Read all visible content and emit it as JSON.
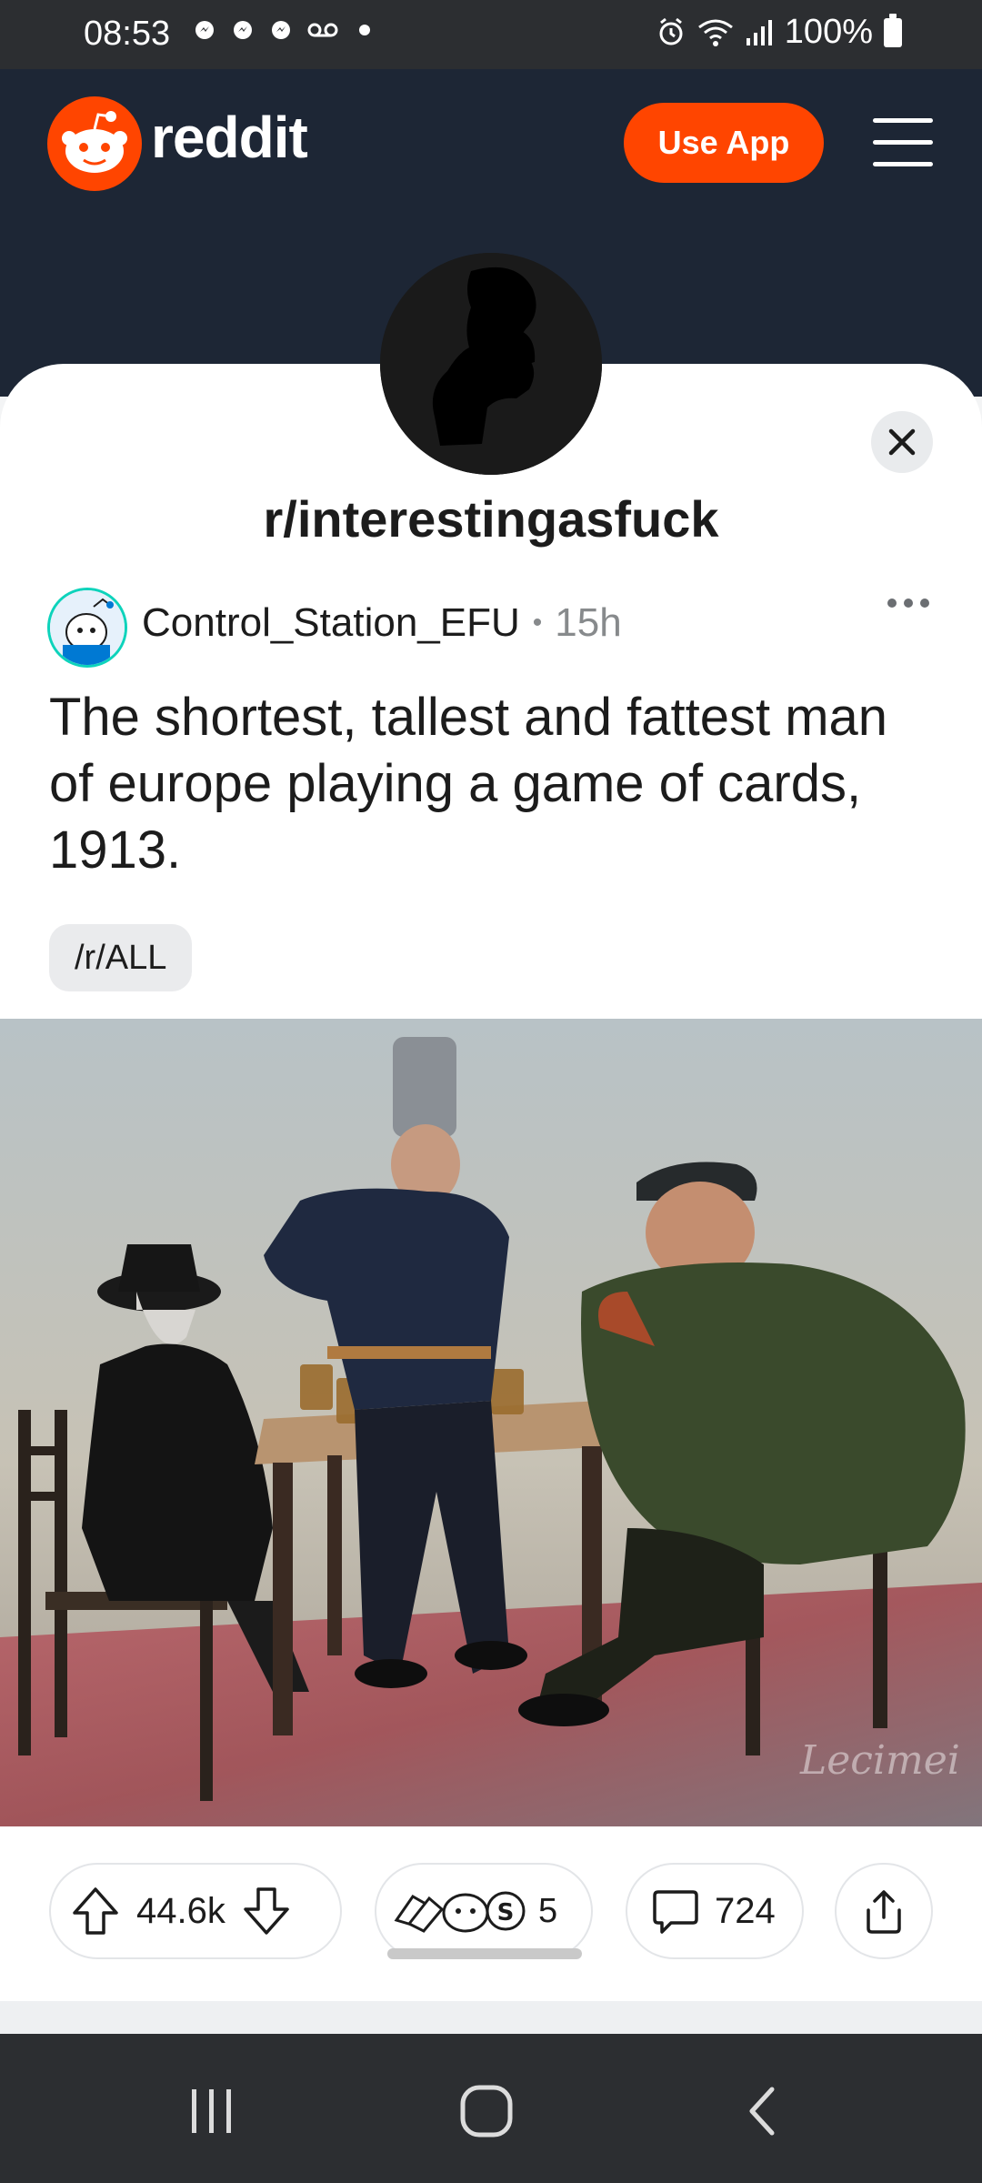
{
  "status_bar": {
    "time": "08:53",
    "battery": "100%",
    "left_icons": [
      "messenger-icon",
      "messenger-icon",
      "messenger-icon",
      "voicemail-icon",
      "dot-icon"
    ],
    "right_icons": [
      "alarm-icon",
      "wifi-icon",
      "signal-icon",
      "battery-icon"
    ]
  },
  "header": {
    "logo_text": "reddit",
    "use_app_label": "Use App",
    "brand_color": "#ff4500",
    "background": "#1d2635"
  },
  "subreddit": {
    "name": "r/interestingasfuck",
    "avatar_icon": "thinker-silhouette-icon"
  },
  "post": {
    "author": "Control_Station_EFU",
    "separator": "•",
    "age": "15h",
    "title": "The shortest, tallest and fattest man of europe playing a game of cards, 1913.",
    "flair": "/r/ALL",
    "image_signature": "Lecimei"
  },
  "actions": {
    "votes": "44.6k",
    "awards_count": "5",
    "comments": "724",
    "icons": [
      "upvote-icon",
      "downvote-icon",
      "award-icons",
      "comment-icon",
      "share-icon"
    ]
  },
  "nav": {
    "buttons": [
      "recents-icon",
      "home-icon",
      "back-icon"
    ]
  }
}
